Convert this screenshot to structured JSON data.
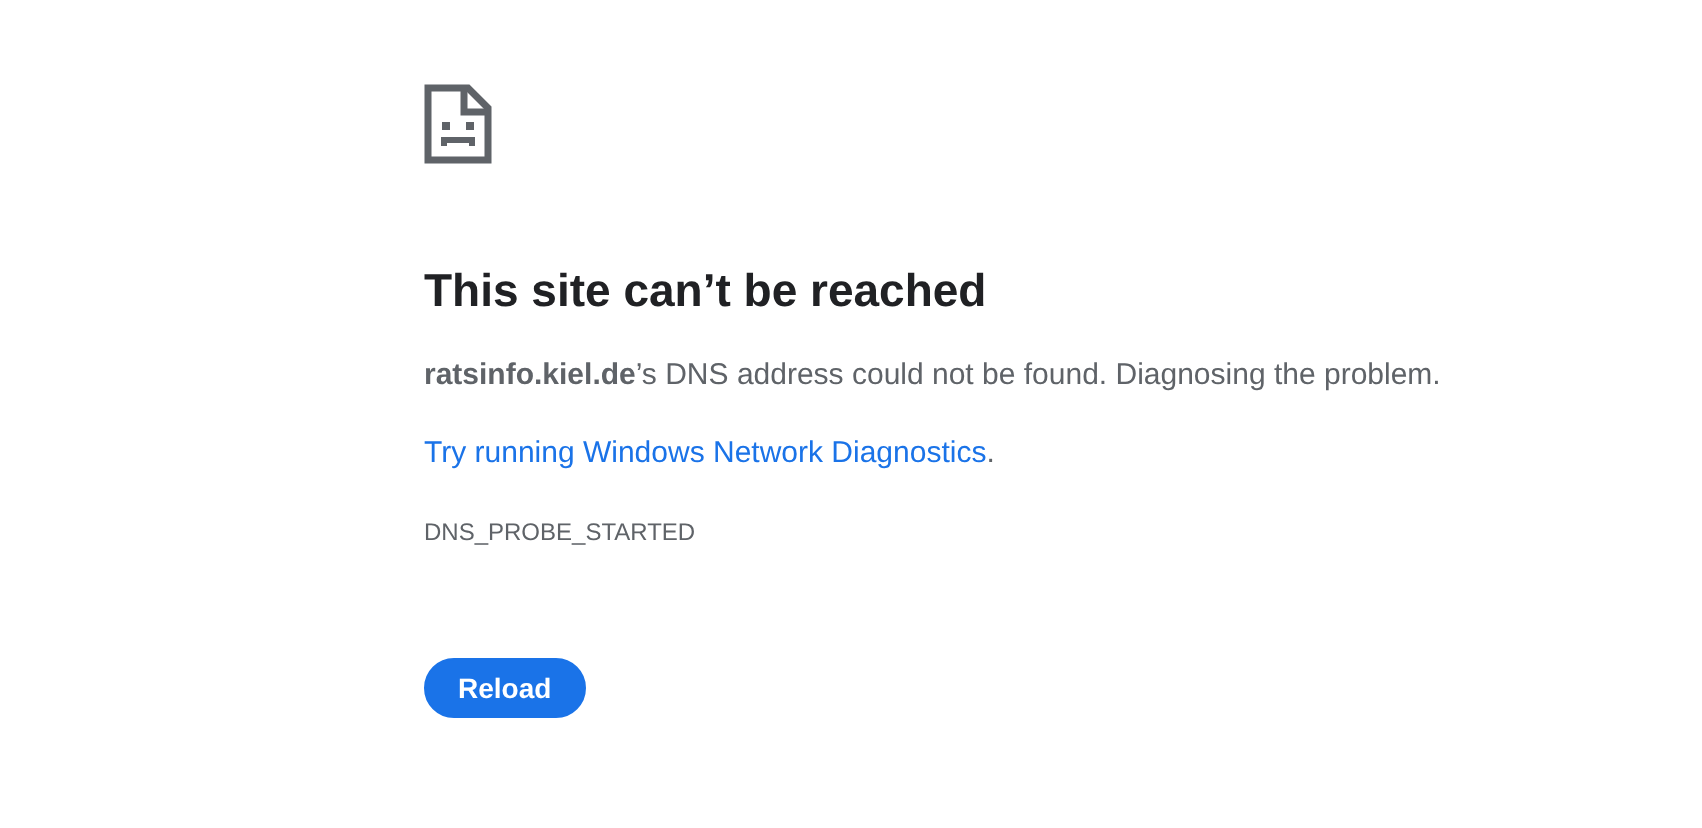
{
  "heading": "This site can’t be reached",
  "message": "**ratsinfo.kiel.de**’s DNS address could not be found. Diagnosing the problem.",
  "suggestion": {
    "link": "Try running Windows Network Diagnostics",
    "after": "."
  },
  "error_code": "DNS_PROBE_STARTED",
  "buttons": [
    {
      "label": "Reload",
      "kind": "primary"
    }
  ]
}
